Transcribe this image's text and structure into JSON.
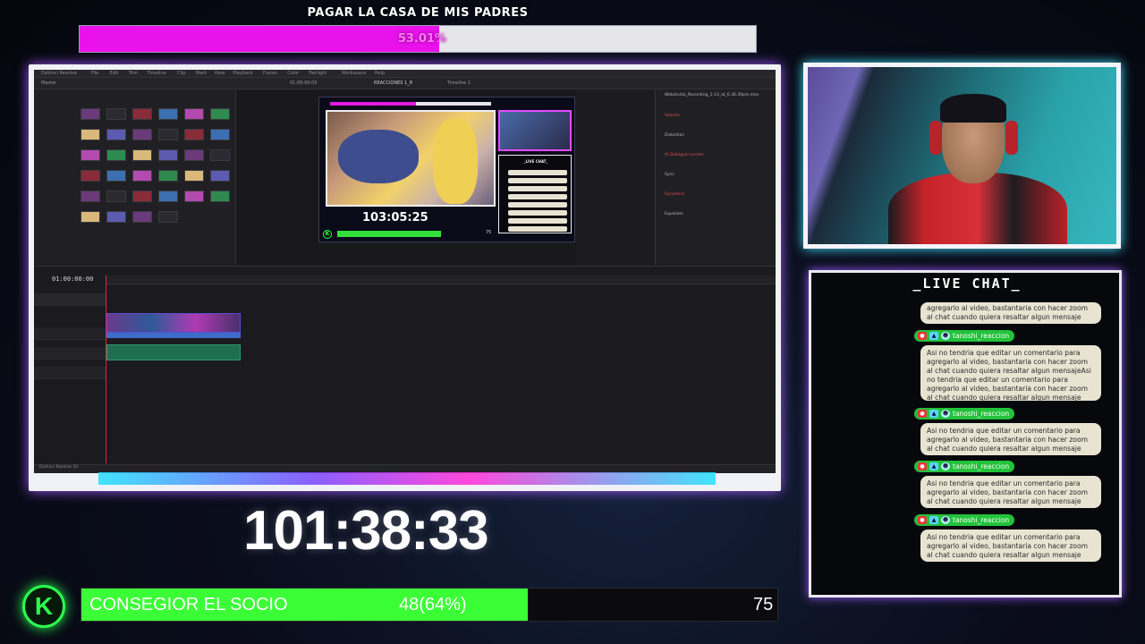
{
  "top_goal": {
    "title": "PAGAR LA CASA DE MIS PADRES",
    "percent_label": "53.01%",
    "fraction": 0.5301,
    "fill_color": "#ea12ea"
  },
  "editor": {
    "project_title": "REACCIONES 1_8",
    "menu": [
      "DaVinci Resolve",
      "File",
      "Edit",
      "Trim",
      "Timeline",
      "Clip",
      "Mark",
      "View",
      "Playback",
      "Fusion",
      "Color",
      "Fairlight",
      "Workspace",
      "Help"
    ],
    "media_pool_label": "Master",
    "timeline_name": "Timeline 1",
    "viewer_timecode": "01:00:00:00",
    "timeline_timecode": "01:00:00:00",
    "inspector": {
      "clip_name": "Webstudio_Recording_1-13_at_6.36.39pm.mov",
      "sections": [
        "Volume",
        "Distortion",
        "AI Dialogue Leveler",
        "Sync",
        "Dynamics",
        "Equalizer"
      ]
    },
    "nested_preview": {
      "timer": "103:05:25",
      "chat_title": "_LIVE CHAT_",
      "socio_value": "75"
    },
    "status_text": "DaVinci Resolve 20"
  },
  "chat": {
    "title": "_LIVE CHAT_",
    "top_fragment": "agregarlo al video, bastantaria con hacer zoom al chat cuando quiera resaltar algun mensaje",
    "messages": [
      {
        "user": "tanoshi_reaccion",
        "text": "Asi no tendria que editar un comentario para agregarlo al video, bastantaria con hacer zoom al chat cuando quiera resaltar algun mensajeAsi no tendria que editar un comentario para agregarlo al video, bastantaria con hacer zoom al chat cuando quiera resaltar algun mensaje"
      },
      {
        "user": "tanoshi_reaccion",
        "text": "Asi no tendria que editar un comentario para agregarlo al video, bastantaria con hacer zoom al chat cuando quiera resaltar algun mensaje"
      },
      {
        "user": "tanoshi_reaccion",
        "text": "Asi no tendria que editar un comentario para agregarlo al video, bastantaria con hacer zoom al chat cuando quiera resaltar algun mensaje"
      },
      {
        "user": "tanoshi_reaccion",
        "text": "Asi no tendria que editar un comentario para agregarlo al video, bastantaria con hacer zoom al chat cuando quiera resaltar algun mensaje"
      }
    ]
  },
  "timer": {
    "value": "101:38:33"
  },
  "socio_goal": {
    "label": "CONSEGIOR EL SOCIO",
    "progress_label": "48(64%)",
    "goal": "75",
    "fraction": 0.64,
    "fill_color": "#3bff36"
  },
  "icons": {
    "kick_logo": "K",
    "chat_badges": [
      "camera-badge-icon",
      "bot-badge-icon",
      "face-badge-icon"
    ]
  }
}
